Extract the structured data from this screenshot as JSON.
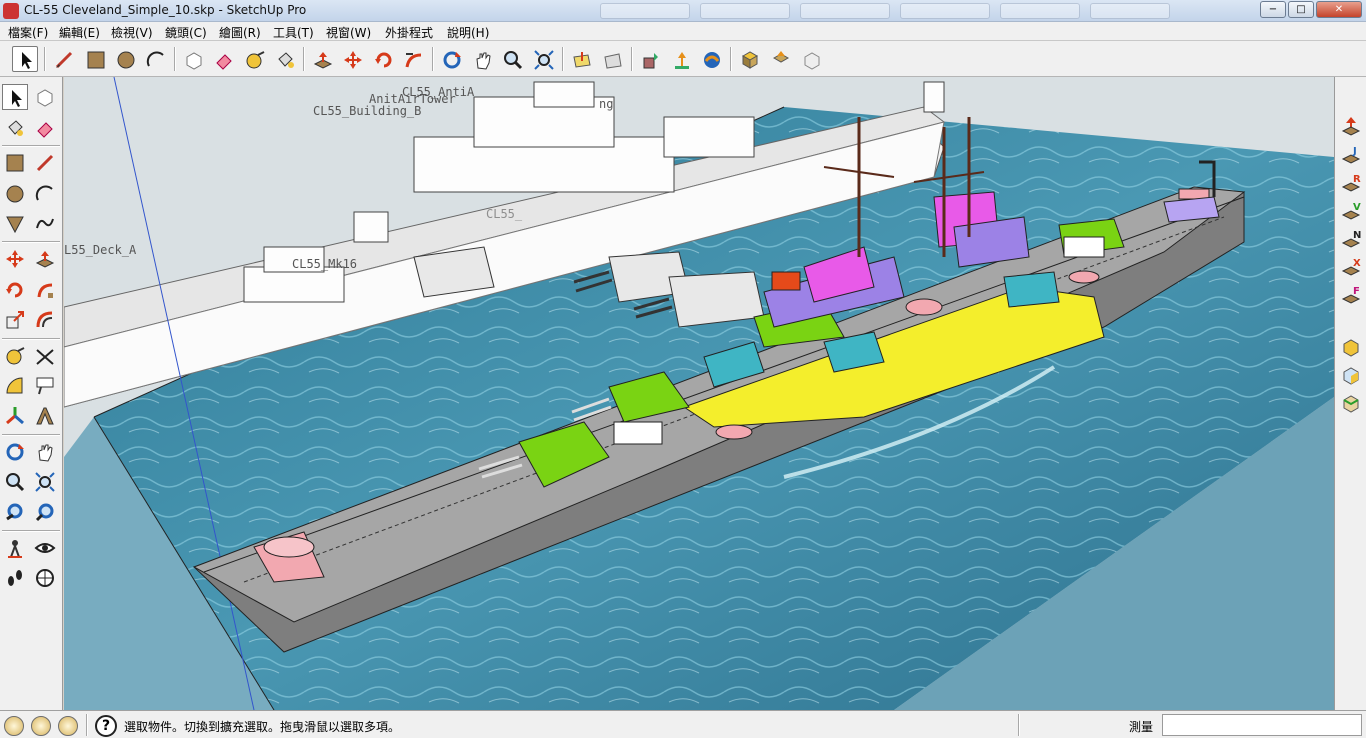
{
  "window": {
    "title": "CL-55 Cleveland_Simple_10.skp - SketchUp Pro",
    "minimize": "−",
    "maximize": "□",
    "close": "✕"
  },
  "menu": [
    "檔案(F)",
    "編輯(E)",
    "檢視(V)",
    "鏡頭(C)",
    "繪圖(R)",
    "工具(T)",
    "視窗(W)",
    "外掛程式",
    "說明(H)"
  ],
  "toolbar_icons": [
    "select-icon",
    "line-icon",
    "rectangle-icon",
    "circle-icon",
    "arc-icon",
    "make-component-icon",
    "eraser-icon",
    "tape-measure-icon",
    "paint-bucket-icon",
    "push-pull-icon",
    "move-icon",
    "rotate-icon",
    "follow-me-icon",
    "orbit-icon",
    "pan-icon",
    "zoom-icon",
    "zoom-extents-icon",
    "add-location-icon",
    "toggle-terrain-icon",
    "get-models-icon",
    "share-model-icon",
    "share-component-icon",
    "component-library-icon",
    "get-photo-texture-icon",
    "extension-warehouse-icon",
    "import-icon",
    "upload-icon"
  ],
  "left_toolbar_icons": [
    "select-icon",
    "make-component-icon",
    "paint-bucket-icon",
    "eraser-icon",
    "rectangle-icon",
    "line-icon",
    "circle-icon",
    "arc-icon",
    "polygon-icon",
    "freehand-icon",
    "move-icon",
    "push-pull-icon",
    "rotate-icon",
    "follow-me-icon",
    "scale-icon",
    "offset-icon",
    "tape-measure-icon",
    "dimension-icon",
    "protractor-icon",
    "text-icon",
    "axes-icon",
    "3d-text-icon",
    "orbit-icon",
    "pan-icon",
    "zoom-icon",
    "zoom-window-icon",
    "previous-view-icon",
    "zoom-extents-icon",
    "position-camera-icon",
    "look-around-icon",
    "walk-icon",
    "section-plane-icon"
  ],
  "right_toolbar": {
    "icons": [
      "sandbox-from-contours-icon",
      "sandbox-from-scratch-icon",
      "smoove-icon",
      "stamp-icon",
      "drape-icon",
      "add-detail-icon",
      "flip-edge-icon",
      "solid-outer-shell-icon",
      "solid-intersect-icon",
      "solid-union-icon"
    ],
    "letters": [
      "J",
      "R",
      "V",
      "N",
      "X",
      "F"
    ]
  },
  "viewport_labels": {
    "anti_a": "CL55_AntiA",
    "anti_tower": "AnitAirTower",
    "building_b": "CL55_Building_B",
    "building_partial": "ng",
    "deck_a": "L55_Deck_A",
    "mk16": "CL55_Mk16",
    "hidden_label": "CL55_"
  },
  "colors": {
    "sea": "#3d8aa5",
    "hull": "#7e7e7e",
    "deck": "#a6a6a6",
    "yellow": "#f4ee2c",
    "green": "#7ad313",
    "magenta": "#e85ae8",
    "violet": "#9c82e6",
    "teal": "#3fb5c4",
    "pink": "#f2a8b0"
  },
  "statusbar": {
    "hint": "選取物件。切換到擴充選取。拖曳滑鼠以選取多項。",
    "measure_label": "測量",
    "measure_value": "",
    "help_glyph": "?"
  }
}
